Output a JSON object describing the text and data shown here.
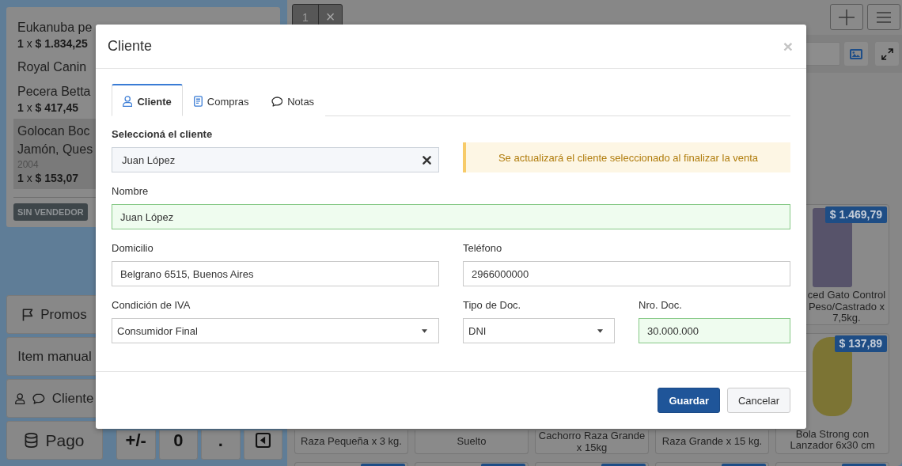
{
  "sale": {
    "items": [
      {
        "name": "Eukanuba pe",
        "amount": "**1** x **$ 1.834,25**",
        "selected": false
      },
      {
        "name": "Royal Canin",
        "selected": false
      },
      {
        "name": "Pecera Betta",
        "amount": "**1** x **$ 417,45**",
        "selected": false
      },
      {
        "name": "Golocan Boc Jamón, Ques",
        "code": "2004",
        "amount": "**1** x **$ 153,07**",
        "selected": true
      }
    ],
    "seller": "SIN VENDEDOR"
  },
  "actions": [
    {
      "kind": "promos",
      "label": "Promos"
    },
    {
      "kind": "manual",
      "label": "Item manual"
    },
    {
      "kind": "client",
      "label": "Cliente"
    },
    {
      "kind": "payment",
      "label": "Pago"
    }
  ],
  "keypad": [
    {
      "kind": "key",
      "label": "+/-"
    },
    {
      "kind": "key",
      "label": "0"
    },
    {
      "kind": "key",
      "label": "."
    },
    {
      "kind": "back"
    }
  ],
  "ticket_tab": {
    "label": "1",
    "close": "×"
  },
  "products": {
    "rows": [
      {
        "cards": [
          {
            "kind": "clipped",
            "price": "$ 1.469,79",
            "name": "ced Gato Control Peso/Castrado x 7,5kg."
          }
        ]
      },
      {
        "cards": [
          {
            "kind": "caption",
            "name": "Raza Pequeña x 3 kg."
          },
          {
            "kind": "caption",
            "name": "Suelto"
          },
          {
            "kind": "caption",
            "name": "Cachorro Raza Grande x 15kg"
          },
          {
            "kind": "caption",
            "name": "Raza Grande x 15 kg."
          },
          {
            "kind": "full",
            "price": "$ 137,89",
            "name": "Bola Strong con Lanzador 6x30 cm"
          }
        ]
      },
      {
        "cards": [
          {
            "kind": "edge"
          },
          {
            "kind": "edge"
          },
          {
            "kind": "edge"
          },
          {
            "kind": "edge"
          },
          {
            "kind": "edge"
          }
        ]
      }
    ]
  },
  "modal": {
    "title": "Cliente",
    "close": "×",
    "tabs": [
      {
        "kind": "client",
        "label": "Cliente",
        "selected": true
      },
      {
        "kind": "purchases",
        "label": "Compras",
        "selected": false
      },
      {
        "kind": "notes",
        "label": "Notas",
        "selected": false
      }
    ],
    "client_select": {
      "label": "Seleccioná el cliente",
      "value": "Juan López"
    },
    "notice": "Se actualizará el cliente seleccionado al finalizar la venta",
    "rows": [
      {
        "fields": [
          {
            "kind": "input",
            "label": "Nombre",
            "value": "Juan López",
            "valid": true
          }
        ]
      },
      {
        "fields": [
          {
            "kind": "input",
            "label": "Domicilio",
            "value": "Belgrano 6515, Buenos Aires",
            "valid": false
          },
          {
            "kind": "input",
            "label": "Teléfono",
            "value": "2966000000",
            "valid": false
          }
        ]
      },
      {
        "fields": [
          {
            "kind": "select",
            "label": "Condición de IVA",
            "value": "Consumidor Final"
          },
          {
            "kind": "select",
            "label": "Tipo de Doc.",
            "value": "DNI"
          },
          {
            "kind": "input",
            "label": "Nro. Doc.",
            "value": "30.000.000",
            "valid": true
          }
        ]
      }
    ],
    "buttons": [
      {
        "kind": "primary",
        "label": "Guardar"
      },
      {
        "kind": "secondary",
        "label": "Cancelar"
      }
    ]
  }
}
